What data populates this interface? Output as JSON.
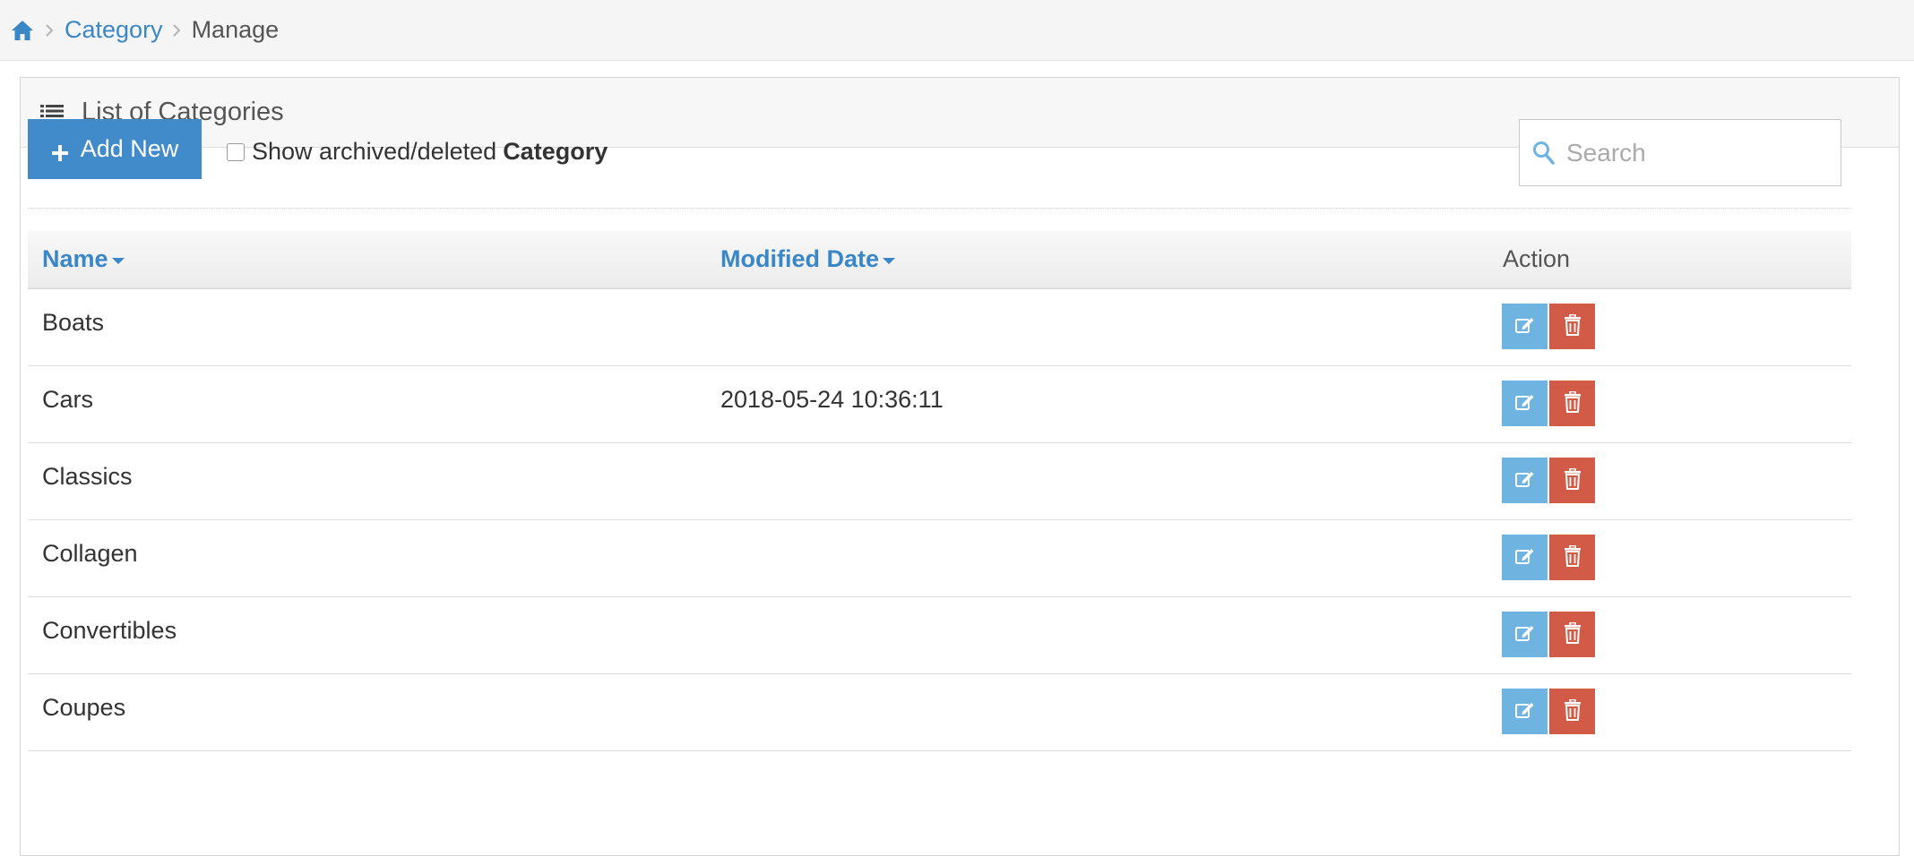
{
  "breadcrumb": {
    "items": [
      {
        "label": "Category",
        "link": true
      },
      {
        "label": "Manage",
        "link": false
      }
    ]
  },
  "widget": {
    "title": "List of Categories"
  },
  "toolbar": {
    "add_label": "Add New",
    "archived_label": "Show archived/deleted",
    "archived_entity": "Category",
    "archived_checked": false,
    "search_placeholder": "Search"
  },
  "table": {
    "columns": [
      {
        "label": "Name",
        "sortable": true
      },
      {
        "label": "Modified Date",
        "sortable": true
      },
      {
        "label": "Action",
        "sortable": false
      }
    ],
    "rows": [
      {
        "name": "Boats",
        "modified": ""
      },
      {
        "name": "Cars",
        "modified": "2018-05-24 10:36:11"
      },
      {
        "name": "Classics",
        "modified": ""
      },
      {
        "name": "Collagen",
        "modified": ""
      },
      {
        "name": "Convertibles",
        "modified": ""
      },
      {
        "name": "Coupes",
        "modified": ""
      }
    ]
  },
  "colors": {
    "accent": "#428bca",
    "link": "#3a87c8",
    "edit_button": "#6fb3e0",
    "delete_button": "#d15b47"
  },
  "icons": {
    "home": "home-icon",
    "list": "list-icon",
    "plus": "plus-icon",
    "search": "search-icon",
    "edit": "edit-icon",
    "delete": "trash-icon"
  }
}
